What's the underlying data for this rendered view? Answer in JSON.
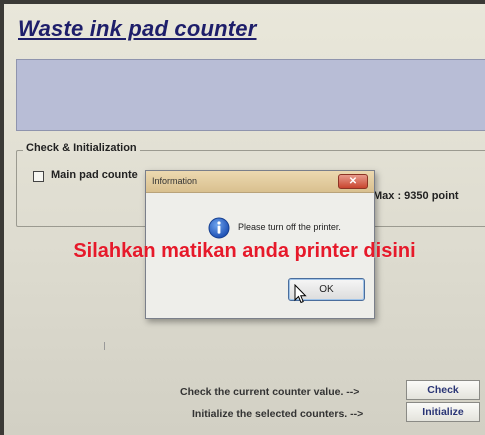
{
  "window": {
    "title": "Waste ink pad counter"
  },
  "group": {
    "label": "Check & Initialization",
    "main_pad_label": "Main pad counte",
    "max_text": "Max : 9350 point"
  },
  "dialog": {
    "title": "Information",
    "message": "Please turn off the printer.",
    "ok_label": "OK",
    "close_glyph": "✕"
  },
  "overlay": {
    "text": "Silahkan matikan anda printer disini",
    "color": "#e6192a"
  },
  "actions": {
    "check_desc": "Check the current counter value. -->",
    "check_label": "Check",
    "init_desc": "Initialize the selected counters. -->",
    "init_label": "Initialize"
  },
  "icons": {
    "info": "info-icon",
    "close": "close-icon",
    "cursor": "mouse-cursor-icon"
  }
}
